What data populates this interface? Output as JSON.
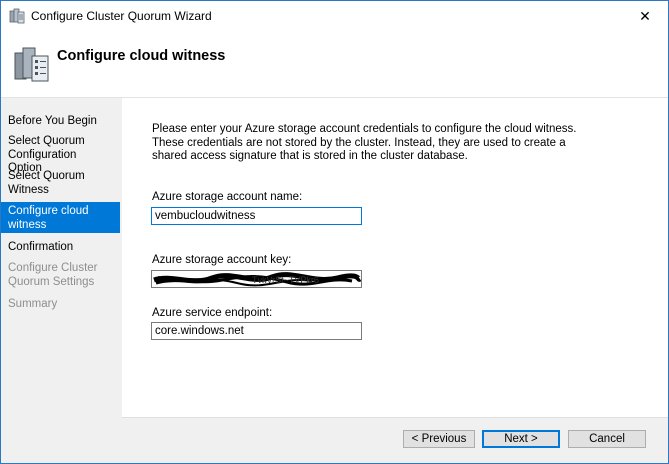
{
  "window": {
    "title": "Configure Cluster Quorum Wizard",
    "close_glyph": "✕"
  },
  "header": {
    "title": "Configure cloud witness"
  },
  "steps": [
    {
      "label": "Before You Begin",
      "state": "normal"
    },
    {
      "label": "Select Quorum Configuration Option",
      "state": "normal"
    },
    {
      "label": "Select Quorum Witness",
      "state": "normal"
    },
    {
      "label": "Configure cloud witness",
      "state": "active"
    },
    {
      "label": "Confirmation",
      "state": "normal"
    },
    {
      "label": "Configure Cluster Quorum Settings",
      "state": "disabled"
    },
    {
      "label": "Summary",
      "state": "disabled"
    }
  ],
  "main": {
    "intro": "Please enter your Azure storage account credentials to configure the cloud witness. These credentials are not stored by the cluster. Instead, they are used to create a shared access signature that is stored in the cluster database.",
    "account_name": {
      "label": "Azure storage account name:",
      "value": "vembucloudwitness"
    },
    "account_key": {
      "label": "Azure storage account key:",
      "value": "",
      "note": "value redacted (scribbled out)"
    },
    "endpoint": {
      "label": "Azure service endpoint:",
      "value": "core.windows.net"
    }
  },
  "buttons": {
    "previous": "< Previous",
    "next": "Next >",
    "cancel": "Cancel"
  },
  "colors": {
    "accent": "#0078d7",
    "panel": "#f0f0f0",
    "border": "#2b79c4"
  }
}
